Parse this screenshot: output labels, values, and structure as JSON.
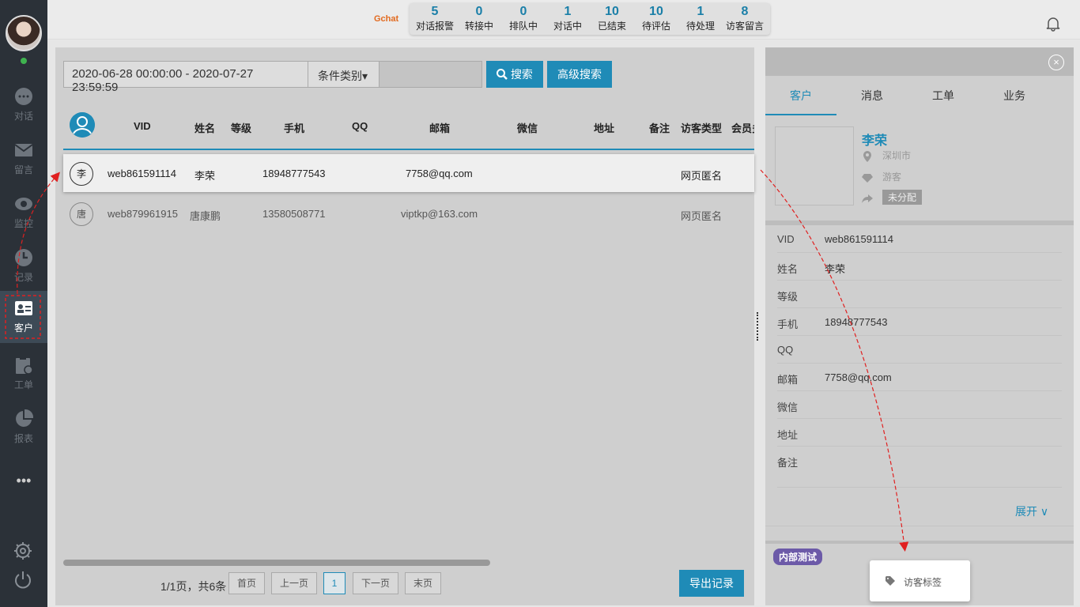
{
  "sidebar": {
    "items": [
      {
        "label": "对话",
        "icon": "chat-icon"
      },
      {
        "label": "留言",
        "icon": "mail-icon"
      },
      {
        "label": "监控",
        "icon": "eye-icon"
      },
      {
        "label": "记录",
        "icon": "clock-icon"
      },
      {
        "label": "客户",
        "icon": "id-card-icon"
      },
      {
        "label": "工单",
        "icon": "clipboard-icon"
      },
      {
        "label": "报表",
        "icon": "pie-chart-icon"
      }
    ],
    "more": "•••"
  },
  "topbar": {
    "logo": "Gchat",
    "stats": [
      {
        "num": "5",
        "label": "对话报警"
      },
      {
        "num": "0",
        "label": "转接中"
      },
      {
        "num": "0",
        "label": "排队中"
      },
      {
        "num": "1",
        "label": "对话中"
      },
      {
        "num": "10",
        "label": "已结束"
      },
      {
        "num": "10",
        "label": "待评估"
      },
      {
        "num": "1",
        "label": "待处理"
      },
      {
        "num": "8",
        "label": "访客留言"
      }
    ]
  },
  "search": {
    "date_range": "2020-06-28 00:00:00 - 2020-07-27 23:59:59",
    "condition_label": "条件类别▾",
    "search_label": "搜索",
    "advanced_label": "高级搜索"
  },
  "table": {
    "headers": [
      "VID",
      "姓名",
      "等级",
      "手机",
      "QQ",
      "邮箱",
      "微信",
      "地址",
      "备注",
      "访客类型",
      "会员多"
    ],
    "rows": [
      {
        "avatar": "李",
        "vid": "web861591114",
        "name": "李荣",
        "phone": "18948777543",
        "email": "7758@qq.com",
        "type": "网页匿名"
      },
      {
        "avatar": "唐",
        "vid": "web879961915",
        "name": "唐康鹏",
        "phone": "13580508771",
        "email": "viptkp@163.com",
        "type": "网页匿名"
      }
    ]
  },
  "pager": {
    "info": "1/1页，共6条",
    "first": "首页",
    "prev": "上一页",
    "current": "1",
    "next": "下一页",
    "last": "末页",
    "export": "导出记录"
  },
  "detail": {
    "close": "×",
    "tabs": [
      "客户",
      "消息",
      "工单",
      "业务"
    ],
    "name": "李荣",
    "city": "深圳市",
    "visitor_kind": "游客",
    "assign_status": "未分配",
    "fields": [
      {
        "label": "VID",
        "value": "web861591114"
      },
      {
        "label": "姓名",
        "value": "李荣"
      },
      {
        "label": "等级",
        "value": ""
      },
      {
        "label": "手机",
        "value": "18948777543"
      },
      {
        "label": "QQ",
        "value": ""
      },
      {
        "label": "邮箱",
        "value": "7758@qq.com"
      },
      {
        "label": "微信",
        "value": ""
      },
      {
        "label": "地址",
        "value": ""
      },
      {
        "label": "备注",
        "value": ""
      }
    ],
    "expand": "展开 ∨",
    "tag": "内部测试",
    "popup": "访客标签"
  },
  "colors": {
    "accent": "#1f8bb7",
    "sidebar": "#2b3138",
    "tag": "#6c5aa8",
    "annotation": "#e02020"
  }
}
